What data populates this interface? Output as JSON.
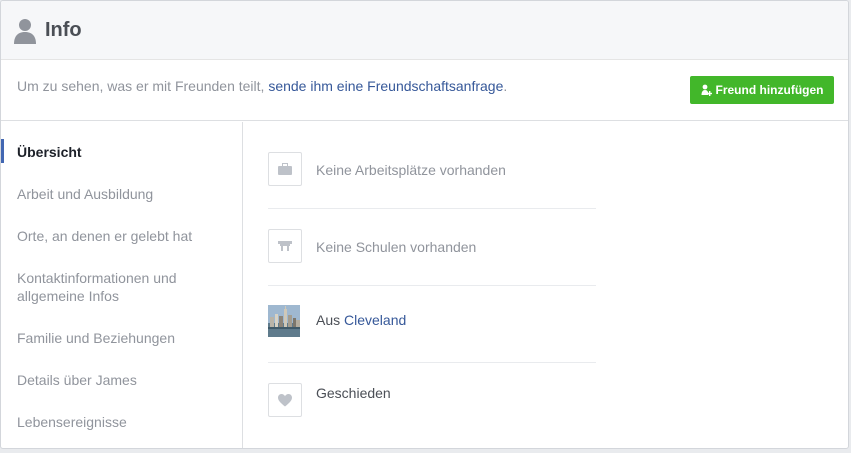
{
  "header": {
    "title": "Info"
  },
  "notice": {
    "prefix": "Um zu sehen, was er mit Freunden teilt, ",
    "link": "sende ihm eine Freundschaftsanfrage",
    "suffix": "."
  },
  "add_friend_button": {
    "label": "Freund hinzufügen"
  },
  "sidebar": {
    "items": [
      {
        "label": "Übersicht",
        "active": true
      },
      {
        "label": "Arbeit und Ausbildung"
      },
      {
        "label": "Orte, an denen er gelebt hat"
      },
      {
        "label": "Kontaktinformationen und allgemeine Infos"
      },
      {
        "label": "Familie und Beziehungen"
      },
      {
        "label": "Details über James"
      },
      {
        "label": "Lebensereignisse"
      }
    ]
  },
  "overview": {
    "work": {
      "label": "Keine Arbeitsplätze vorhanden",
      "icon": "briefcase-icon"
    },
    "school": {
      "label": "Keine Schulen vorhanden",
      "icon": "school-icon"
    },
    "hometown": {
      "prefix": "Aus ",
      "city": "Cleveland"
    },
    "relationship": {
      "label": "Geschieden",
      "icon": "heart-icon"
    }
  },
  "colors": {
    "link": "#365899",
    "button": "#42b72a",
    "muted": "#90949c",
    "active_bar": "#4267b2"
  }
}
